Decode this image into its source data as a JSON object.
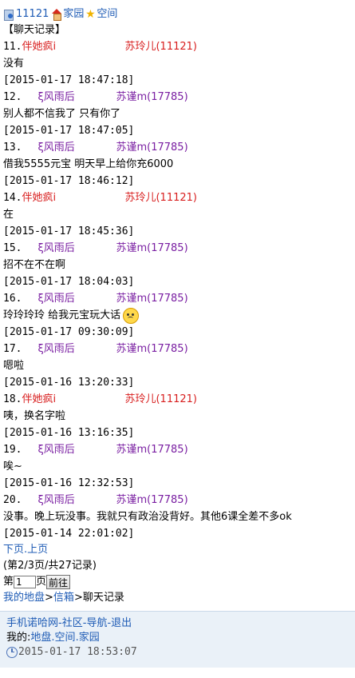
{
  "header": {
    "user_id": "11121",
    "home_label": "家园",
    "space_label": "空间"
  },
  "section_title": "【聊天记录】",
  "messages": [
    {
      "num": "11.",
      "sender": "伴她疯i",
      "sender_color": "red",
      "receiver": "苏玲儿(11121)",
      "text": "没有",
      "emoji": false,
      "time": "[2015-01-17 18:47:18]"
    },
    {
      "num": "12.",
      "sender": "ξ风雨后",
      "sender_color": "purple",
      "receiver": "苏谨m(17785)",
      "text": "别人都不信我了 只有你了",
      "emoji": false,
      "time": "[2015-01-17 18:47:05]"
    },
    {
      "num": "13.",
      "sender": "ξ风雨后",
      "sender_color": "purple",
      "receiver": "苏谨m(17785)",
      "text": "借我5555元宝 明天早上给你充6000",
      "emoji": false,
      "time": "[2015-01-17 18:46:12]"
    },
    {
      "num": "14.",
      "sender": "伴她疯i",
      "sender_color": "red",
      "receiver": "苏玲儿(11121)",
      "text": "在",
      "emoji": false,
      "time": "[2015-01-17 18:45:36]"
    },
    {
      "num": "15.",
      "sender": "ξ风雨后",
      "sender_color": "purple",
      "receiver": "苏谨m(17785)",
      "text": "招不在不在啊",
      "emoji": false,
      "time": "[2015-01-17 18:04:03]"
    },
    {
      "num": "16.",
      "sender": "ξ风雨后",
      "sender_color": "purple",
      "receiver": "苏谨m(17785)",
      "text": "玲玲玲玲 给我元宝玩大话",
      "emoji": true,
      "time": "[2015-01-17 09:30:09]"
    },
    {
      "num": "17.",
      "sender": "ξ风雨后",
      "sender_color": "purple",
      "receiver": "苏谨m(17785)",
      "text": "嗯啦",
      "emoji": false,
      "time": "[2015-01-16 13:20:33]"
    },
    {
      "num": "18.",
      "sender": "伴她疯i",
      "sender_color": "red",
      "receiver": "苏玲儿(11121)",
      "text": "咦，换名字啦",
      "emoji": false,
      "time": "[2015-01-16 13:16:35]"
    },
    {
      "num": "19.",
      "sender": "ξ风雨后",
      "sender_color": "purple",
      "receiver": "苏谨m(17785)",
      "text": "唉~",
      "emoji": false,
      "time": "[2015-01-16 12:32:53]"
    },
    {
      "num": "20.",
      "sender": "ξ风雨后",
      "sender_color": "purple",
      "receiver": "苏谨m(17785)",
      "text": "没事。晚上玩没事。我就只有政治没背好。其他6课全差不多ok",
      "emoji": false,
      "time": "[2015-01-14 22:01:02]"
    }
  ],
  "pagination": {
    "next_label": "下页",
    "prev_label": "上页",
    "info": "(第2/3页/共27记录)",
    "page_prefix": "第",
    "page_value": "1",
    "page_suffix": "页",
    "go_label": "前往"
  },
  "breadcrumb": {
    "my_land": "我的地盘",
    "inbox": "信箱",
    "current": "聊天记录"
  },
  "footer": {
    "site": "手机诺哈网",
    "community": "社区",
    "nav": "导航",
    "logout": "退出",
    "mine_prefix": "我的:",
    "disk": "地盘",
    "space": "空间",
    "home": "家园",
    "timestamp": "2015-01-17 18:53:07"
  },
  "colors": {
    "link": "#1e5bb5",
    "red": "#d81e1e",
    "purple": "#7a1fa2",
    "footer_bg": "#eaf1f8"
  },
  "icons": {
    "user": "user-icon",
    "home": "home-icon",
    "space": "star-icon",
    "emoji": "crying-face-icon",
    "clock": "clock-icon"
  }
}
